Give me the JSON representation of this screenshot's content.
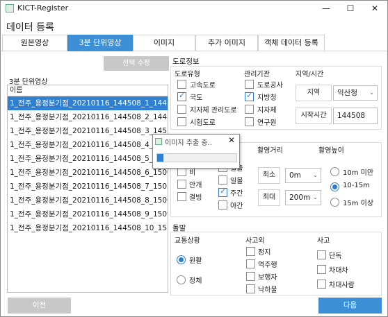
{
  "window": {
    "title": "KICT-Register",
    "minimize": "—",
    "maximize": "☐",
    "close": "✕"
  },
  "header": "데이터 등록",
  "tabs": [
    "원본영상",
    "3분 단위영상",
    "이미지",
    "추가 이미지",
    "객체 데이터 등록"
  ],
  "left": {
    "select_button": "선택 수정",
    "list_label": "3분 단위영상",
    "list_header": "이름",
    "rows": [
      "1_전주_용정분기점_20210116_144508_1_144508.r",
      "1_전주_용정분기점_20210116_144508_2_144808.r",
      "1_전주_용정분기점_20210116_144508_3_145108.r",
      "1_전주_용정분기점_20210116_144508_4_145408.r",
      "1_전주_용정분기점_20210116_144508_5_145708.r",
      "1_전주_용정분기점_20210116_144508_6_150008.r",
      "1_전주_용정분기점_20210116_144508_7_150308.r",
      "1_전주_용정분기점_20210116_144508_8_150608.r",
      "1_전주_용정분기점_20210116_144508_9_150908.r",
      "1_전주_용정분기점_20210116_144508_10_151208"
    ],
    "selected_index": 0
  },
  "road": {
    "section": "도로정보",
    "type_title": "도로유형",
    "types": [
      {
        "label": "고속도로",
        "checked": false
      },
      {
        "label": "국도",
        "checked": true
      },
      {
        "label": "지자체 관리도로",
        "checked": false
      },
      {
        "label": "시험도로",
        "checked": false
      }
    ],
    "agency_title": "관리기관",
    "agencies": [
      {
        "label": "도로공사",
        "checked": false
      },
      {
        "label": "지방청",
        "checked": true
      },
      {
        "label": "지자체",
        "checked": false
      },
      {
        "label": "연구원",
        "checked": false
      }
    ],
    "region_title": "지역/시간",
    "region_label": "지역",
    "region_value": "익산청",
    "start_label": "시작시간",
    "start_value": "144508"
  },
  "env": {
    "weather": [
      {
        "label": "눈",
        "checked": false
      },
      {
        "label": "비",
        "checked": false
      },
      {
        "label": "안개",
        "checked": false
      },
      {
        "label": "결빙",
        "checked": false
      }
    ],
    "time": [
      {
        "label": "일출",
        "checked": false
      },
      {
        "label": "일몰",
        "checked": false
      },
      {
        "label": "주간",
        "checked": true
      },
      {
        "label": "야간",
        "checked": false
      }
    ],
    "distance_title": "촬영거리",
    "min_label": "최소",
    "min_value": "0m",
    "max_label": "최대",
    "max_value": "200m",
    "height_title": "촬영높이",
    "heights": [
      {
        "label": "10m 미만",
        "checked": false
      },
      {
        "label": "10-15m",
        "checked": true
      },
      {
        "label": "15m 이상",
        "checked": false
      }
    ]
  },
  "sudden": {
    "section": "돌발",
    "traffic_title": "교통상황",
    "traffic": [
      {
        "label": "원활",
        "checked": true
      },
      {
        "label": "정체",
        "checked": false
      }
    ],
    "other_title": "사고외",
    "other": [
      {
        "label": "정지",
        "checked": false
      },
      {
        "label": "역주행",
        "checked": false
      },
      {
        "label": "보행자",
        "checked": false
      },
      {
        "label": "낙하물",
        "checked": false
      }
    ],
    "accident_title": "사고",
    "accident": [
      {
        "label": "단독",
        "checked": false
      },
      {
        "label": "차대차",
        "checked": false
      },
      {
        "label": "차대사람",
        "checked": false
      }
    ]
  },
  "dialog": {
    "title": "이미지 추출 중..",
    "close": "✕",
    "progress": 0.08
  },
  "nav": {
    "prev": "이전",
    "next": "다음"
  }
}
